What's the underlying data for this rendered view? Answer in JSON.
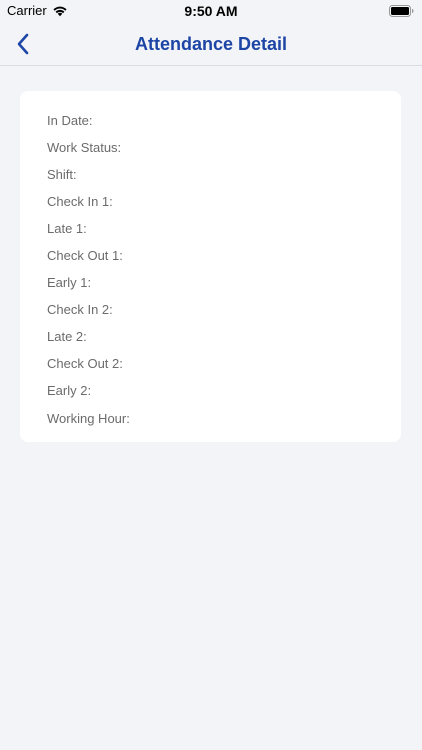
{
  "status_bar": {
    "carrier": "Carrier",
    "time": "9:50 AM",
    "icons": [
      "wifi-icon",
      "battery-icon"
    ]
  },
  "nav": {
    "back_icon": "chevron-left-icon",
    "title": "Attendance Detail",
    "accent_color": "#1c45a6"
  },
  "detail": {
    "rows": [
      {
        "label": "In Date:",
        "value": ""
      },
      {
        "label": "Work Status:",
        "value": ""
      },
      {
        "label": "Shift:",
        "value": ""
      },
      {
        "label": "Check In 1:",
        "value": ""
      },
      {
        "label": "Late 1:",
        "value": ""
      },
      {
        "label": "Check Out 1:",
        "value": ""
      },
      {
        "label": "Early 1:",
        "value": ""
      },
      {
        "label": "Check In 2:",
        "value": ""
      },
      {
        "label": "Late 2:",
        "value": ""
      },
      {
        "label": "Check Out 2:",
        "value": ""
      },
      {
        "label": "Early 2:",
        "value": ""
      },
      {
        "label": "Working Hour:",
        "value": ""
      }
    ]
  }
}
